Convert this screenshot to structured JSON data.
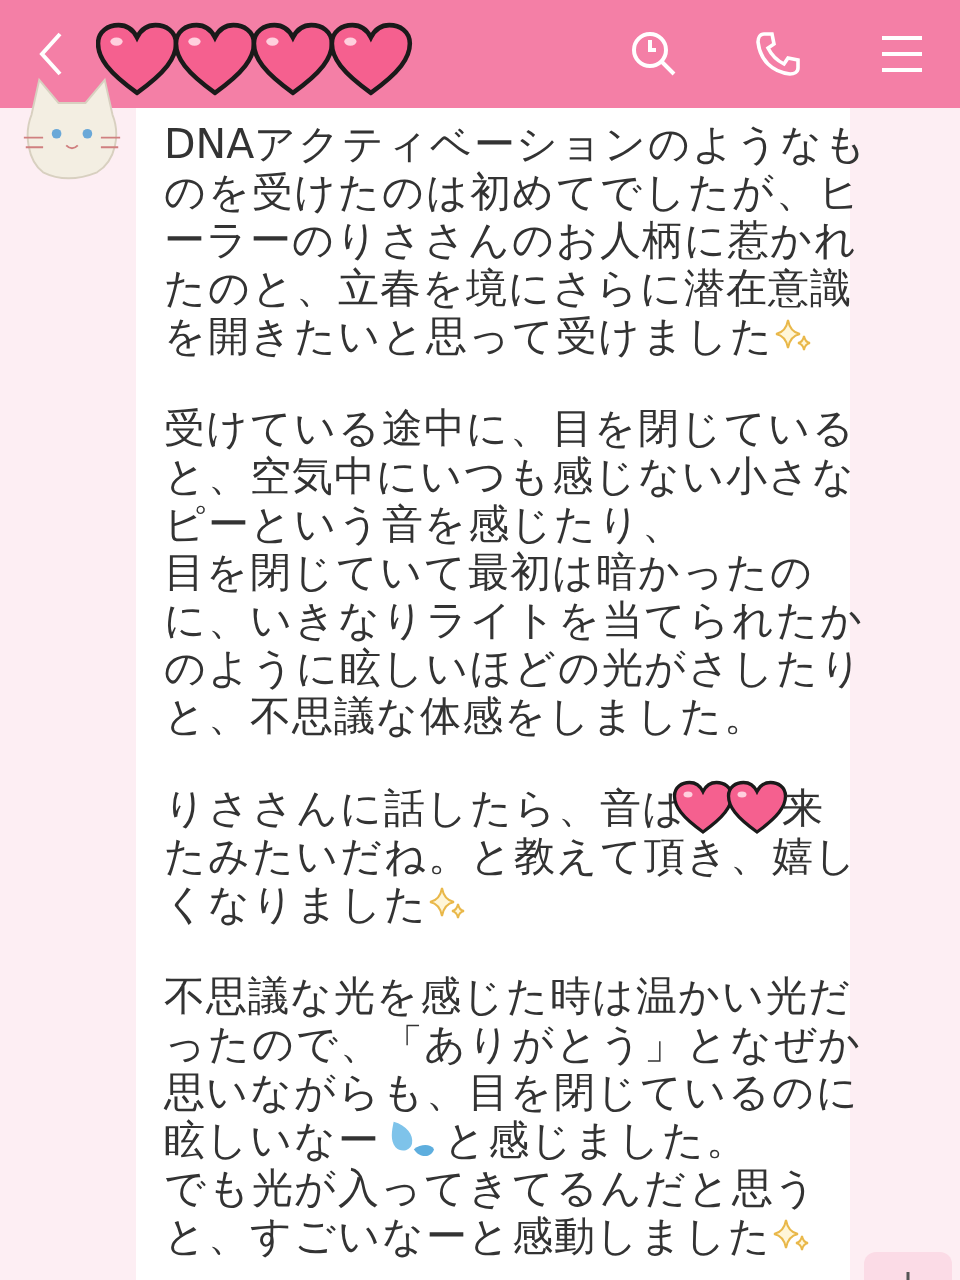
{
  "message": {
    "paragraphs": [
      {
        "lines": [
          [
            {
              "kind": "text",
              "text": "DNAアクティベーションのようなも"
            }
          ],
          [
            {
              "kind": "text",
              "text": "のを受けたのは初めてでしたが、ヒ"
            }
          ],
          [
            {
              "kind": "text",
              "text": "ーラーのりささんのお人柄に惹かれ"
            }
          ],
          [
            {
              "kind": "text",
              "text": "たのと、立春を境にさらに潜在意識"
            }
          ],
          [
            {
              "kind": "text",
              "text": "を開きたいと思って受けました"
            },
            {
              "kind": "sparkle"
            }
          ]
        ]
      },
      {
        "lines": [
          [
            {
              "kind": "text",
              "text": "受けている途中に、目を閉じている"
            }
          ],
          [
            {
              "kind": "text",
              "text": "と、空気中にいつも感じない小さな"
            }
          ],
          [
            {
              "kind": "text",
              "text": "ピーという音を感じたり、"
            }
          ],
          [
            {
              "kind": "text",
              "text": "目を閉じていて最初は暗かったの"
            }
          ],
          [
            {
              "kind": "text",
              "text": "に、いきなりライトを当てられたか"
            }
          ],
          [
            {
              "kind": "text",
              "text": "のように眩しいほどの光がさしたり"
            }
          ],
          [
            {
              "kind": "text",
              "text": "と、不思議な体感をしました。"
            }
          ]
        ]
      },
      {
        "lines": [
          [
            {
              "kind": "text",
              "text": "りささんに話したら、音は"
            },
            {
              "kind": "hearts"
            },
            {
              "kind": "text",
              "text": "来"
            }
          ],
          [
            {
              "kind": "text",
              "text": "たみたいだね。と教えて頂き、嬉し"
            }
          ],
          [
            {
              "kind": "text",
              "text": "くなりました"
            },
            {
              "kind": "sparkle"
            }
          ]
        ]
      },
      {
        "lines": [
          [
            {
              "kind": "text",
              "text": "不思議な光を感じた時は温かい光だ"
            }
          ],
          [
            {
              "kind": "text",
              "text": "ったので、「ありがとう」となぜか"
            }
          ],
          [
            {
              "kind": "text",
              "text": "思いながらも、目を閉じているのに"
            }
          ],
          [
            {
              "kind": "text",
              "text": "眩しいなー"
            },
            {
              "kind": "droplet"
            },
            {
              "kind": "text",
              "text": "と感じました。"
            }
          ],
          [
            {
              "kind": "text",
              "text": "でも光が入ってきてるんだと思う"
            }
          ],
          [
            {
              "kind": "text",
              "text": "と、すごいなーと感動しました"
            },
            {
              "kind": "sparkle"
            }
          ]
        ]
      }
    ]
  }
}
